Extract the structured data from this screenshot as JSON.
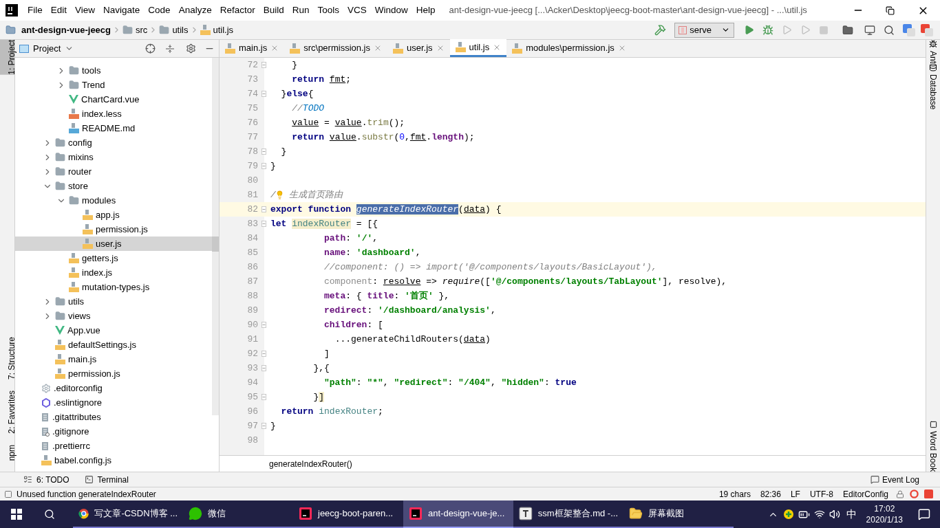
{
  "window": {
    "title": "ant-design-vue-jeecg [...\\Acker\\Desktop\\jeecg-boot-master\\ant-design-vue-jeecg] - ...\\util.js"
  },
  "menu": [
    "File",
    "Edit",
    "View",
    "Navigate",
    "Code",
    "Analyze",
    "Refactor",
    "Build",
    "Run",
    "Tools",
    "VCS",
    "Window",
    "Help"
  ],
  "breadcrumb": [
    {
      "label": "ant-design-vue-jeecg",
      "kind": "project"
    },
    {
      "label": "src",
      "kind": "folder"
    },
    {
      "label": "utils",
      "kind": "folder"
    },
    {
      "label": "util.js",
      "kind": "js"
    }
  ],
  "run_config": {
    "label": "serve"
  },
  "left_strip": [
    {
      "label": "1: Project",
      "selected": true,
      "kind": "top"
    },
    {
      "label": "7: Structure",
      "selected": false,
      "kind": "bottom"
    },
    {
      "label": "2: Favorites",
      "selected": false,
      "kind": "bottom"
    },
    {
      "label": "npm",
      "selected": false,
      "kind": "bottom"
    }
  ],
  "right_strip": [
    {
      "label": "Ant",
      "kind": "top"
    },
    {
      "label": "Database",
      "kind": "top"
    },
    {
      "label": "Word Book",
      "kind": "bottom"
    }
  ],
  "project_panel": {
    "title": "Project"
  },
  "tree": [
    {
      "children": [
        {
          "children": [
            {
              "label": "tools",
              "kind": "folder",
              "expanded": false,
              "selected": false
            },
            {
              "label": "Trend",
              "kind": "folder",
              "expanded": false,
              "selected": false
            },
            {
              "label": "ChartCard.vue",
              "kind": "vue",
              "selected": false
            },
            {
              "label": "index.less",
              "kind": "less",
              "selected": false
            },
            {
              "label": "README.md",
              "kind": "md",
              "selected": false
            }
          ]
        },
        {
          "label": "config",
          "kind": "folder",
          "expanded": false,
          "selected": false
        },
        {
          "label": "mixins",
          "kind": "folder",
          "expanded": false,
          "selected": false
        },
        {
          "label": "router",
          "kind": "folder",
          "expanded": false,
          "selected": false
        },
        {
          "label": "store",
          "kind": "folder",
          "expanded": true,
          "selected": false,
          "children": [
            {
              "label": "modules",
              "kind": "folder",
              "expanded": true,
              "selected": false,
              "children": [
                {
                  "label": "app.js",
                  "kind": "js",
                  "selected": false
                },
                {
                  "label": "permission.js",
                  "kind": "js",
                  "selected": false
                },
                {
                  "label": "user.js",
                  "kind": "js",
                  "selected": true
                }
              ]
            },
            {
              "label": "getters.js",
              "kind": "js",
              "selected": false
            },
            {
              "label": "index.js",
              "kind": "js",
              "selected": false
            },
            {
              "label": "mutation-types.js",
              "kind": "js",
              "selected": false
            }
          ]
        },
        {
          "label": "utils",
          "kind": "folder",
          "expanded": false,
          "selected": false
        },
        {
          "label": "views",
          "kind": "folder",
          "expanded": false,
          "selected": false
        },
        {
          "label": "App.vue",
          "kind": "vue",
          "selected": false
        },
        {
          "label": "defaultSettings.js",
          "kind": "js",
          "selected": false
        },
        {
          "label": "main.js",
          "kind": "js",
          "selected": false
        },
        {
          "label": "permission.js",
          "kind": "js",
          "selected": false
        }
      ]
    },
    {
      "label": ".editorconfig",
      "kind": "config",
      "selected": false
    },
    {
      "label": ".eslintignore",
      "kind": "eslint",
      "selected": false
    },
    {
      "label": ".gitattributes",
      "kind": "text",
      "selected": false
    },
    {
      "label": ".gitignore",
      "kind": "ignore",
      "selected": false
    },
    {
      "label": ".prettierrc",
      "kind": "text",
      "selected": false
    },
    {
      "label": "babel.config.js",
      "kind": "js",
      "selected": false
    }
  ],
  "editor_tabs": [
    {
      "label": "main.js",
      "selected": false
    },
    {
      "label": "src\\permission.js",
      "selected": false
    },
    {
      "label": "user.js",
      "selected": false
    },
    {
      "label": "util.js",
      "selected": true
    },
    {
      "label": "modules\\permission.js",
      "selected": false
    }
  ],
  "code": [
    {
      "number": "72",
      "fold": true,
      "current": false,
      "tokens": [
        {
          "text": "    }",
          "kind": "p"
        }
      ]
    },
    {
      "number": "73",
      "fold": false,
      "current": false,
      "tokens": [
        {
          "text": "    return",
          "kind": "kw"
        },
        {
          "text": " fmt",
          "kind": "ul"
        },
        {
          "text": ";",
          "kind": "p"
        }
      ]
    },
    {
      "number": "74",
      "fold": true,
      "current": false,
      "tokens": [
        {
          "text": "  }",
          "kind": "p"
        },
        {
          "text": "else",
          "kind": "kw"
        },
        {
          "text": "{",
          "kind": "p"
        }
      ]
    },
    {
      "number": "75",
      "fold": false,
      "current": false,
      "tokens": [
        {
          "text": "    //",
          "kind": "cmt"
        },
        {
          "text": "TODO",
          "kind": "todo"
        }
      ]
    },
    {
      "number": "76",
      "fold": false,
      "current": false,
      "tokens": [
        {
          "text": "    value",
          "kind": "ul"
        },
        {
          "text": " = ",
          "kind": "p"
        },
        {
          "text": "value",
          "kind": "ul"
        },
        {
          "text": ".",
          "kind": "p"
        },
        {
          "text": "trim",
          "kind": "fn"
        },
        {
          "text": "();",
          "kind": "p"
        }
      ]
    },
    {
      "number": "77",
      "fold": false,
      "current": false,
      "tokens": [
        {
          "text": "    return",
          "kind": "kw"
        },
        {
          "text": " value",
          "kind": "ul"
        },
        {
          "text": ".",
          "kind": "p"
        },
        {
          "text": "substr",
          "kind": "fn"
        },
        {
          "text": "(",
          "kind": "p"
        },
        {
          "text": "0",
          "kind": "num"
        },
        {
          "text": ",",
          "kind": "p"
        },
        {
          "text": "fmt",
          "kind": "ul"
        },
        {
          "text": ".",
          "kind": "p"
        },
        {
          "text": "length",
          "kind": "prop"
        },
        {
          "text": ");",
          "kind": "p"
        }
      ]
    },
    {
      "number": "78",
      "fold": true,
      "current": false,
      "tokens": [
        {
          "text": "  }",
          "kind": "p"
        }
      ]
    },
    {
      "number": "79",
      "fold": true,
      "current": false,
      "tokens": [
        {
          "text": "}",
          "kind": "p"
        }
      ]
    },
    {
      "number": "80",
      "fold": false,
      "current": false
    },
    {
      "number": "81",
      "fold": false,
      "current": false,
      "tokens": [
        {
          "text": "/",
          "kind": "cmt"
        },
        {
          "kind": "bulb"
        },
        {
          "text": " 生成首页路由",
          "kind": "cmt"
        }
      ]
    },
    {
      "number": "82",
      "fold": true,
      "current": true,
      "tokens": [
        {
          "text": "export function",
          "kind": "kw"
        },
        {
          "text": " generateIndexRouter",
          "kind": "sel"
        },
        {
          "text": "(",
          "kind": "p"
        },
        {
          "text": "data",
          "kind": "ul"
        },
        {
          "text": ") {",
          "kind": "p"
        }
      ]
    },
    {
      "number": "83",
      "fold": true,
      "current": false,
      "tokens": [
        {
          "text": "let",
          "kind": "kw"
        },
        {
          "text": " indexRouter",
          "kind": "decl"
        },
        {
          "text": " = [{",
          "kind": "p"
        }
      ]
    },
    {
      "number": "84",
      "fold": false,
      "current": false,
      "tokens": [
        {
          "text": "          path",
          "kind": "prop"
        },
        {
          "text": ": ",
          "kind": "p"
        },
        {
          "text": "'/'",
          "kind": "str"
        },
        {
          "text": ",",
          "kind": "p"
        }
      ]
    },
    {
      "number": "85",
      "fold": false,
      "current": false,
      "tokens": [
        {
          "text": "          name",
          "kind": "prop"
        },
        {
          "text": ": ",
          "kind": "p"
        },
        {
          "text": "'dashboard'",
          "kind": "str"
        },
        {
          "text": ",",
          "kind": "p"
        }
      ]
    },
    {
      "number": "86",
      "fold": false,
      "current": false,
      "tokens": [
        {
          "text": "          //component: () => import('@/components/layouts/BasicLayout'),",
          "kind": "cmt"
        }
      ]
    },
    {
      "number": "87",
      "fold": false,
      "current": false,
      "tokens": [
        {
          "text": "          component",
          "kind": "dim"
        },
        {
          "text": ": ",
          "kind": "p"
        },
        {
          "text": "resolve",
          "kind": "ul"
        },
        {
          "text": " => ",
          "kind": "p"
        },
        {
          "text": "require",
          "kind": "it"
        },
        {
          "text": "([",
          "kind": "p"
        },
        {
          "text": "'@/components/layouts/TabLayout'",
          "kind": "str"
        },
        {
          "text": "], resolve),",
          "kind": "p"
        }
      ]
    },
    {
      "number": "88",
      "fold": false,
      "current": false,
      "tokens": [
        {
          "text": "          meta",
          "kind": "prop"
        },
        {
          "text": ": { ",
          "kind": "p"
        },
        {
          "text": "title",
          "kind": "prop"
        },
        {
          "text": ": ",
          "kind": "p"
        },
        {
          "text": "'首页'",
          "kind": "str"
        },
        {
          "text": " },",
          "kind": "p"
        }
      ]
    },
    {
      "number": "89",
      "fold": false,
      "current": false,
      "tokens": [
        {
          "text": "          redirect",
          "kind": "prop"
        },
        {
          "text": ": ",
          "kind": "p"
        },
        {
          "text": "'/dashboard/analysis'",
          "kind": "str"
        },
        {
          "text": ",",
          "kind": "p"
        }
      ]
    },
    {
      "number": "90",
      "fold": true,
      "current": false,
      "tokens": [
        {
          "text": "          children",
          "kind": "prop"
        },
        {
          "text": ": [",
          "kind": "p"
        }
      ]
    },
    {
      "number": "91",
      "fold": false,
      "current": false,
      "tokens": [
        {
          "text": "            ...generateChildRouters(",
          "kind": "p"
        },
        {
          "text": "data",
          "kind": "ul"
        },
        {
          "text": ")",
          "kind": "p"
        }
      ]
    },
    {
      "number": "92",
      "fold": true,
      "current": false,
      "tokens": [
        {
          "text": "          ]",
          "kind": "p"
        }
      ]
    },
    {
      "number": "93",
      "fold": true,
      "current": false,
      "tokens": [
        {
          "text": "        },{",
          "kind": "p"
        }
      ]
    },
    {
      "number": "94",
      "fold": false,
      "current": false,
      "tokens": [
        {
          "text": "          \"path\"",
          "kind": "str"
        },
        {
          "text": ": ",
          "kind": "p"
        },
        {
          "text": "\"*\"",
          "kind": "str"
        },
        {
          "text": ", ",
          "kind": "p"
        },
        {
          "text": "\"redirect\"",
          "kind": "str"
        },
        {
          "text": ": ",
          "kind": "p"
        },
        {
          "text": "\"/404\"",
          "kind": "str"
        },
        {
          "text": ", ",
          "kind": "p"
        },
        {
          "text": "\"hidden\"",
          "kind": "str"
        },
        {
          "text": ": ",
          "kind": "p"
        },
        {
          "text": "true",
          "kind": "kw"
        }
      ]
    },
    {
      "number": "95",
      "fold": true,
      "current": false,
      "tokens": [
        {
          "text": "        }",
          "kind": "p"
        },
        {
          "text": "]",
          "kind": "match"
        }
      ]
    },
    {
      "number": "96",
      "fold": false,
      "current": false,
      "tokens": [
        {
          "text": "  return",
          "kind": "kw"
        },
        {
          "text": " indexRouter",
          "kind": "local"
        },
        {
          "text": ";",
          "kind": "p"
        }
      ]
    },
    {
      "number": "97",
      "fold": true,
      "current": false,
      "tokens": [
        {
          "text": "}",
          "kind": "p"
        }
      ]
    },
    {
      "number": "98",
      "fold": false,
      "current": false
    }
  ],
  "code_breadcrumb": "generateIndexRouter()",
  "tool_tabs": [
    {
      "label": "6: TODO",
      "kind": "todo"
    },
    {
      "label": "Terminal",
      "kind": "terminal"
    }
  ],
  "event_log": "Event Log",
  "status": {
    "message": "Unused function generateIndexRouter",
    "items": [
      "19 chars",
      "82:36",
      "LF",
      "UTF-8",
      "EditorConfig"
    ]
  },
  "taskbar": {
    "apps": [
      {
        "label": "写文章-CSDN博客 ...",
        "kind": "browser",
        "selected": false
      },
      {
        "label": "微信",
        "kind": "chat",
        "selected": false
      },
      {
        "label": "jeecg-boot-paren...",
        "kind": "ide",
        "selected": false
      },
      {
        "label": "ant-design-vue-je...",
        "kind": "ide",
        "selected": true
      },
      {
        "label": "ssm框架整合.md -...",
        "kind": "editor",
        "selected": false
      },
      {
        "label": "屏幕截图",
        "kind": "folder",
        "selected": false
      }
    ],
    "ime": "中",
    "time": "17:02",
    "date": "2020/1/13"
  }
}
